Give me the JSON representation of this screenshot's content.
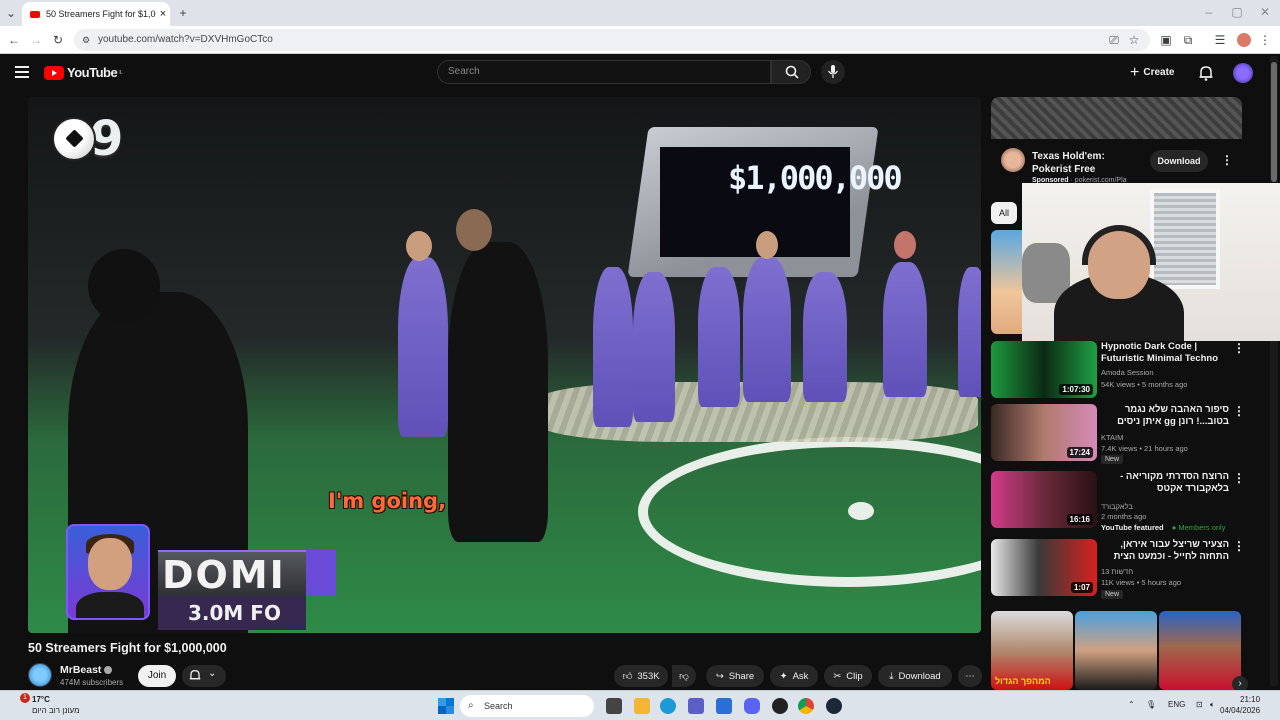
{
  "browser": {
    "tab_title": "50 Streamers Fight for $1,000,0",
    "tab_close": "×",
    "new_tab": "+",
    "url": "youtube.com/watch?v=DXVHmGoCTco"
  },
  "youtube": {
    "logo_text": "YouTube",
    "logo_region": "IL",
    "search_placeholder": "Search",
    "create_label": "Create"
  },
  "video": {
    "overlay_number": "9",
    "screen_money": "$1,000,000",
    "subtitle": "I'm going,",
    "card_name": "DOMI",
    "card_followers": "3.0M FO",
    "title": "50 Streamers Fight for $1,000,000",
    "channel": "MrBeast",
    "subscribers": "474M subscribers",
    "join_label": "Join",
    "likes": "353K",
    "share_label": "Share",
    "ask_label": "Ask",
    "clip_label": "Clip",
    "download_label": "Download"
  },
  "sidebar": {
    "ad": {
      "title": "Texas Hold'em: Pokerist Free",
      "sponsored": "Sponsored",
      "domain": "pokerist.com/Pla",
      "download_label": "Download"
    },
    "chip_all": "All",
    "recommendations": [
      {
        "title": "Hypnotic Dark Code | Futuristic Minimal Techno Vibes",
        "channel": "Amoda Session",
        "meta": "54K views • 5 months ago",
        "duration": "1:07:30",
        "badge": "",
        "extra": ""
      },
      {
        "title": "סיפור האהבה שלא נגמר בטוב...! רונן gg איתן ניסים",
        "channel": "KTAIM",
        "meta": "7.4K views • 21 hours ago",
        "duration": "17:24",
        "badge": "New",
        "extra": ""
      },
      {
        "title": "הרוצח הסדרתי מקוריאה - בלאקבורד אקטס",
        "channel": "בלאקבורד",
        "meta": "2 months ago",
        "duration": "16:16",
        "badge": "",
        "extra": "YouTube featured",
        "extra2": "Members only"
      },
      {
        "title": "הצעיר שריצל עבור איראן, התחזה לחייל - וכמעט הצית מלחמה",
        "channel": "חדשות 13",
        "meta": "11K views • 5 hours ago",
        "duration": "1:07",
        "badge": "New",
        "extra": ""
      }
    ],
    "shorts_caption": "המהפך הגדול"
  },
  "taskbar": {
    "temp": "17°C",
    "weather_desc": "מעונן רוב היום",
    "search_label": "Search",
    "lang": "ENG",
    "time": "21:10",
    "date": "04/04/2026",
    "notification_count": "1"
  },
  "colors": {
    "yt_red": "#ff0000",
    "player_purple": "#6a4bd8",
    "subtitle_orange": "#ff6a3d",
    "members_green": "#2ba640"
  }
}
